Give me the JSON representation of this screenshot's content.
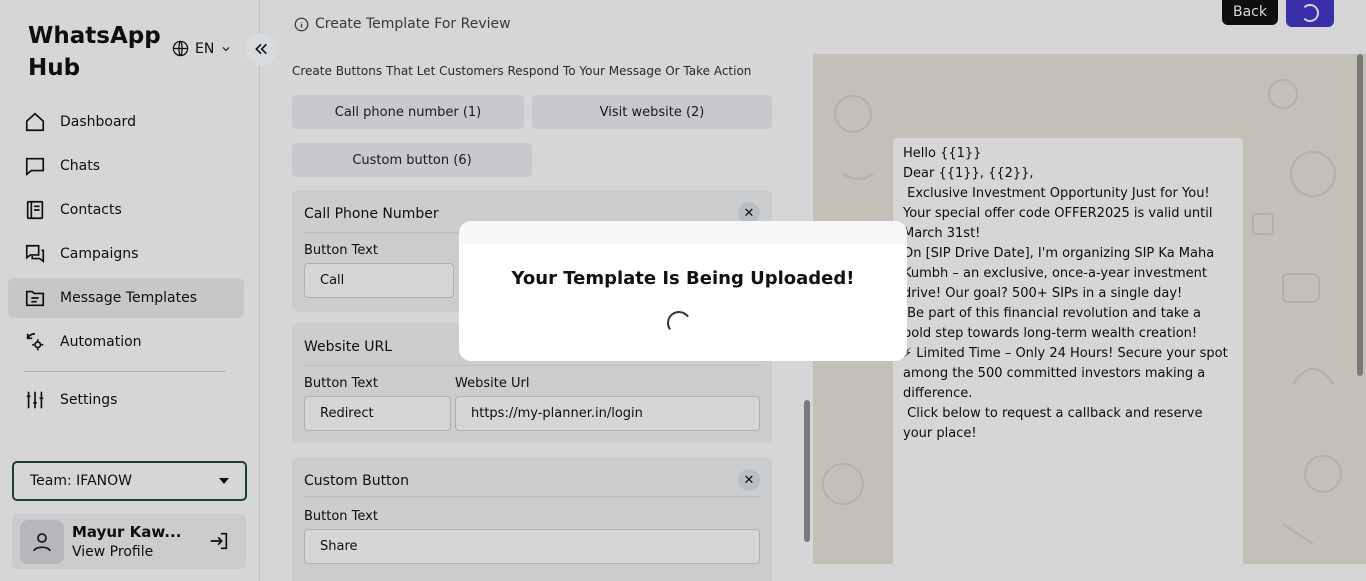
{
  "sidebar": {
    "brand": "WhatsApp Hub",
    "language": "EN",
    "items": [
      {
        "label": "Dashboard"
      },
      {
        "label": "Chats"
      },
      {
        "label": "Contacts"
      },
      {
        "label": "Campaigns"
      },
      {
        "label": "Message Templates"
      },
      {
        "label": "Automation"
      }
    ],
    "settings_label": "Settings",
    "team": "Team: IFANOW",
    "profile": {
      "name": "Mayur Kaw...",
      "link": "View Profile"
    }
  },
  "header": {
    "subtitle": "Create Template For Review",
    "back_label": "Back"
  },
  "buttons_section": {
    "description": "Create Buttons That Let Customers Respond To Your Message Or Take Action",
    "pills": [
      "Call phone number (1)",
      "Visit website (2)",
      "Custom button (6)"
    ],
    "call_card": {
      "title": "Call Phone Number",
      "button_text_label": "Button Text",
      "button_text_value": "Call"
    },
    "website_card": {
      "title": "Website URL",
      "button_text_label": "Button Text",
      "button_text_value": "Redirect",
      "url_label": "Website Url",
      "url_value": "https://my-planner.in/login"
    },
    "custom_card": {
      "title": "Custom Button",
      "button_text_label": "Button Text",
      "button_text_value": "Share"
    }
  },
  "preview": {
    "lines": [
      "Hello {{1}}",
      "Dear {{1}}, {{2}},",
      "",
      " Exclusive Investment Opportunity Just for You!",
      "",
      "Your special offer code OFFER2025 is valid until March 31st!",
      "",
      "On [SIP Drive Date], I'm organizing SIP Ka Maha Kumbh – an exclusive, once-a-year investment drive! Our goal? 500+ SIPs in a single day!",
      "",
      " Be part of this financial revolution and take a bold step towards long-term wealth creation!",
      "",
      "⚡ Limited Time – Only 24 Hours! Secure your spot among the 500 committed investors making a difference.",
      "",
      " Click below to request a callback and reserve your place!"
    ]
  },
  "modal": {
    "title": "Your Template Is Being Uploaded!"
  },
  "colors": {
    "accent": "#4338ca",
    "team_border": "#1f4d3a",
    "preview_bg": "#e9e5dc"
  }
}
